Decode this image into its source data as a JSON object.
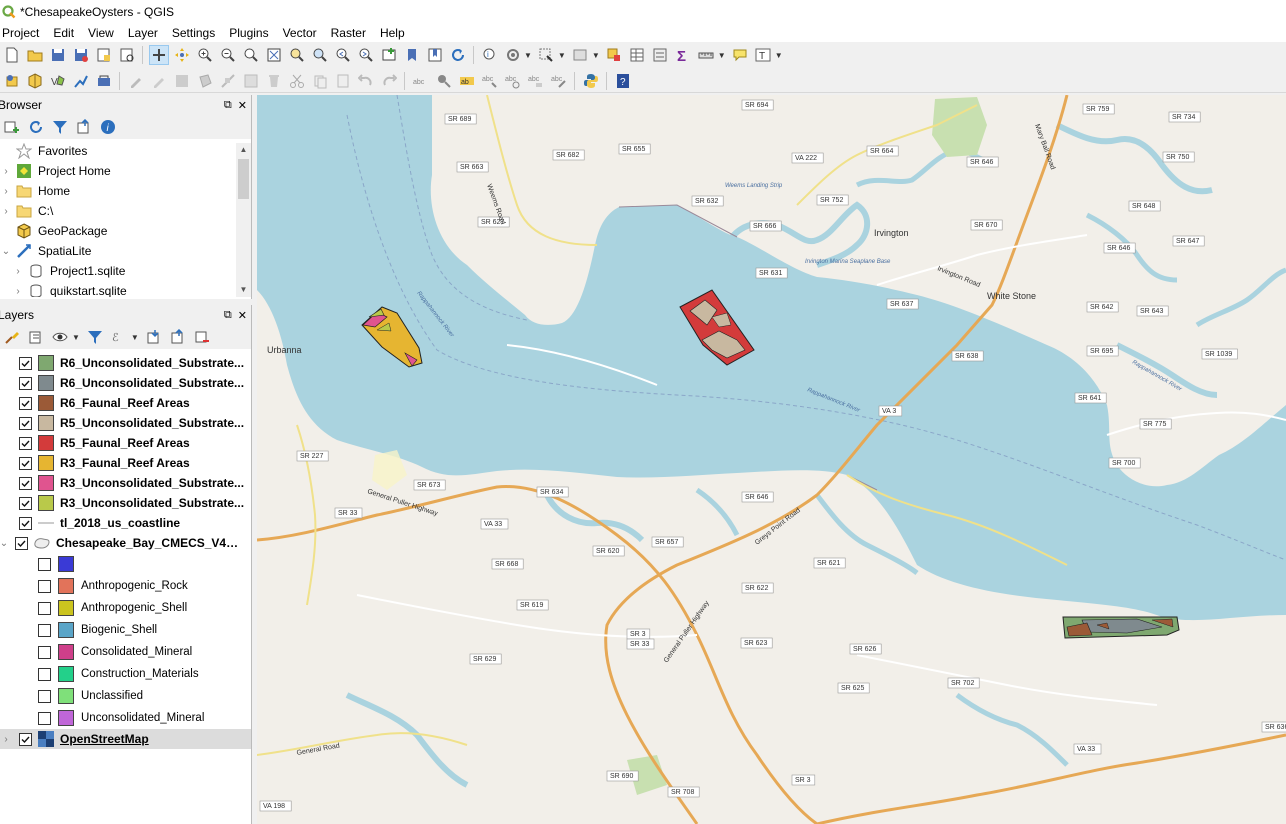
{
  "window": {
    "title": "*ChesapeakeOysters - QGIS"
  },
  "menu": [
    "Project",
    "Edit",
    "View",
    "Layer",
    "Settings",
    "Plugins",
    "Vector",
    "Raster",
    "Help"
  ],
  "browser": {
    "title": "Browser",
    "items": [
      {
        "label": "Favorites",
        "icon": "star-icon"
      },
      {
        "label": "Project Home",
        "icon": "project-home-icon"
      },
      {
        "label": "Home",
        "icon": "folder-icon"
      },
      {
        "label": "C:\\",
        "icon": "folder-icon"
      },
      {
        "label": "GeoPackage",
        "icon": "geopackage-icon"
      },
      {
        "label": "SpatiaLite",
        "icon": "spatialite-icon"
      },
      {
        "label": "Project1.sqlite",
        "icon": "database-icon"
      },
      {
        "label": "quikstart.sqlite",
        "icon": "database-icon"
      }
    ]
  },
  "layers": {
    "title": "Layers",
    "items": [
      {
        "label": "R6_Unconsolidated_Substrate...",
        "color": "#7fa870",
        "checked": true
      },
      {
        "label": "R6_Unconsolidated_Substrate...",
        "color": "#7f8a8e",
        "checked": true
      },
      {
        "label": "R6_Faunal_Reef Areas",
        "color": "#9b5a37",
        "checked": true
      },
      {
        "label": "R5_Unconsolidated_Substrate...",
        "color": "#c8b8a0",
        "checked": true
      },
      {
        "label": "R5_Faunal_Reef Areas",
        "color": "#d33b3b",
        "checked": true
      },
      {
        "label": "R3_Faunal_Reef Areas",
        "color": "#e6b531",
        "checked": true
      },
      {
        "label": "R3_Unconsolidated_Substrate...",
        "color": "#e0548f",
        "checked": true
      },
      {
        "label": "R3_Unconsolidated_Substrate...",
        "color": "#b9c94a",
        "checked": true
      },
      {
        "label": "tl_2018_us_coastline",
        "color": "",
        "checked": true
      },
      {
        "label": "Chesapeake_Bay_CMECS_V4_S...",
        "color": "",
        "checked": true
      },
      {
        "label": "",
        "color": "#3a3ad6",
        "checked": false
      },
      {
        "label": "Anthropogenic_Rock",
        "color": "#e2735a",
        "checked": false
      },
      {
        "label": "Anthropogenic_Shell",
        "color": "#cbc41f",
        "checked": false
      },
      {
        "label": "Biogenic_Shell",
        "color": "#5aa5c8",
        "checked": false
      },
      {
        "label": "Consolidated_Mineral",
        "color": "#cf3f8a",
        "checked": false
      },
      {
        "label": "Construction_Materials",
        "color": "#23d08a",
        "checked": false
      },
      {
        "label": "Unclassified",
        "color": "#7fe07a",
        "checked": false
      },
      {
        "label": "Unconsolidated_Mineral",
        "color": "#c066d8",
        "checked": false
      },
      {
        "label": "OpenStreetMap",
        "color": "",
        "checked": true
      }
    ]
  },
  "map": {
    "places": [
      "Irvington",
      "White Stone",
      "Urbanna"
    ],
    "poi": [
      "Weems Landing Strip",
      "Irvington Marina Seaplane Base"
    ],
    "water_labels": [
      "Rappahannock River",
      "Rappahannock River",
      "Rappahannock River"
    ],
    "roads": [
      "SR 689",
      "SR 682",
      "SR 655",
      "SR 663",
      "SR 627",
      "SR 694",
      "VA 222",
      "SR 664",
      "SR 646",
      "SR 759",
      "SR 734",
      "SR 750",
      "SR 632",
      "SR 752",
      "SR 666",
      "SR 670",
      "SR 648",
      "SR 646",
      "SR 647",
      "SR 631",
      "SR 637",
      "SR 642",
      "SR 643",
      "SR 638",
      "SR 695",
      "SR 1039",
      "SR 641",
      "VA 3",
      "SR 775",
      "SR 700",
      "SR 227",
      "SR 673",
      "SR 634",
      "SR 646",
      "SR 33",
      "VA 33",
      "SR 620",
      "SR 657",
      "SR 621",
      "SR 668",
      "SR 622",
      "SR 619",
      "SR 3",
      "SR 33",
      "SR 623",
      "SR 626",
      "SR 629",
      "SR 625",
      "SR 702",
      "SR 636",
      "VA 33",
      "VA 198",
      "SR 690",
      "SR 708",
      "SR 3"
    ],
    "road_names": [
      "Mary Ball Road",
      "General Puller Highway",
      "Greys Point Road",
      "Irvington Road",
      "General Puller Highway",
      "Weems Road",
      "General Road"
    ]
  }
}
